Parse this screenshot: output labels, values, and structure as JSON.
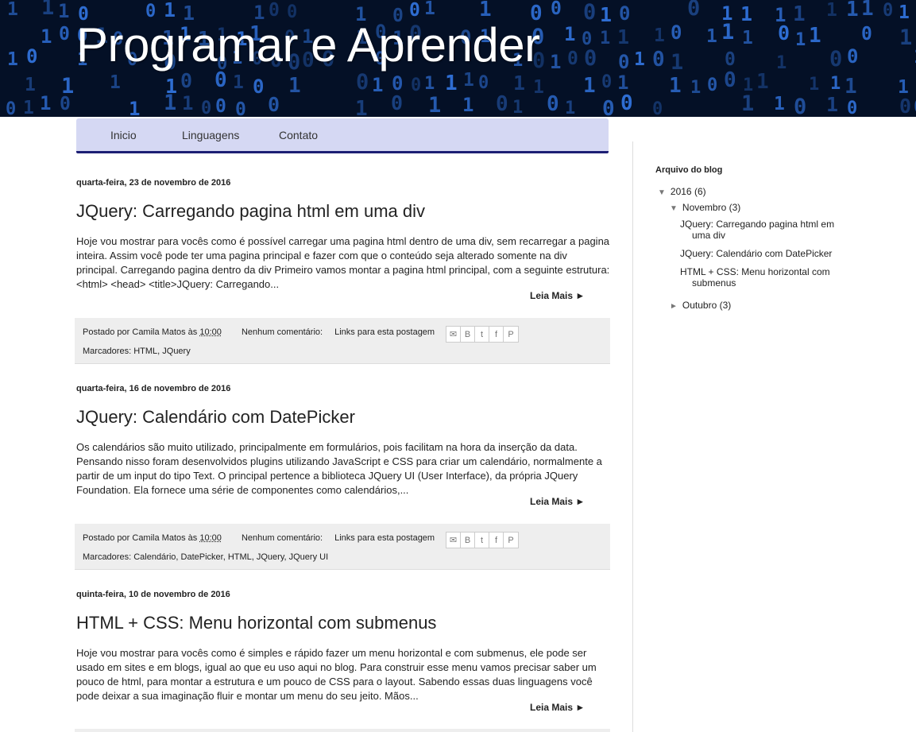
{
  "header": {
    "title": "Programar e Aprender"
  },
  "nav": {
    "items": [
      "Inicio",
      "Linguagens",
      "Contato"
    ]
  },
  "posts": [
    {
      "date": "quarta-feira, 23 de novembro de 2016",
      "title": "JQuery: Carregando pagina html em uma div",
      "body": "Hoje vou mostrar para vocês como é possível carregar uma pagina html dentro de uma div, sem recarregar a pagina inteira. Assim você pode ter uma pagina principal e fazer com que o conteúdo seja alterado somente na div principal. Carregando pagina dentro da div Primeiro vamos montar a pagina html principal, com a seguinte estrutura: <html> <head> <title>JQuery: Carregando...",
      "read_more": "Leia Mais ►",
      "posted_by": "Postado por Camila Matos às",
      "time": "10:00",
      "comments": "Nenhum comentário:",
      "links": "Links para esta postagem",
      "labels_prefix": "Marcadores:",
      "labels": "HTML, JQuery"
    },
    {
      "date": "quarta-feira, 16 de novembro de 2016",
      "title": "JQuery: Calendário com DatePicker",
      "body": "Os calendários são muito utilizado, principalmente em formulários, pois facilitam na hora da inserção da data. Pensando nisso foram desenvolvidos  plugins utilizando JavaScript e CSS para criar um calendário, normalmente a partir de um input do tipo Text. O principal pertence a biblioteca JQuery UI (User Interface), da própria JQuery Foundation. Ela fornece uma série de componentes como calendários,...",
      "read_more": "Leia Mais ►",
      "posted_by": "Postado por Camila Matos às",
      "time": "10:00",
      "comments": "Nenhum comentário:",
      "links": "Links para esta postagem",
      "labels_prefix": "Marcadores:",
      "labels": "Calendário, DatePicker, HTML, JQuery, JQuery UI"
    },
    {
      "date": "quinta-feira, 10 de novembro de 2016",
      "title": "HTML + CSS: Menu horizontal com submenus",
      "body": "Hoje vou mostrar para vocês como é simples e rápido fazer um menu horizontal e com submenus, ele pode ser usado em sites e em blogs, igual ao que eu uso aqui no blog.  Para construir esse menu vamos precisar saber um pouco de html, para montar a estrutura e um pouco de CSS para o layout. Sabendo essas duas linguagens você pode deixar a sua imaginação fluir e montar um menu do seu jeito. Mãos...",
      "read_more": "Leia Mais ►"
    }
  ],
  "share_icons": [
    "email-icon",
    "blogger-icon",
    "twitter-icon",
    "facebook-icon",
    "pinterest-icon"
  ],
  "sidebar": {
    "archive_title": "Arquivo do blog",
    "year": {
      "label": "2016",
      "count": "(6)",
      "toggle": "▼"
    },
    "months": [
      {
        "label": "Novembro",
        "count": "(3)",
        "toggle": "▼",
        "posts": [
          "JQuery: Carregando pagina html em uma div",
          "JQuery: Calendário com DatePicker",
          "HTML + CSS: Menu horizontal com submenus"
        ]
      },
      {
        "label": "Outubro",
        "count": "(3)",
        "toggle": "►"
      }
    ]
  },
  "colors": {
    "nav_bg": "#d5d8f3",
    "nav_border": "#1d1f74",
    "header_bg": "#041026",
    "digits": "#2f6fd6"
  }
}
